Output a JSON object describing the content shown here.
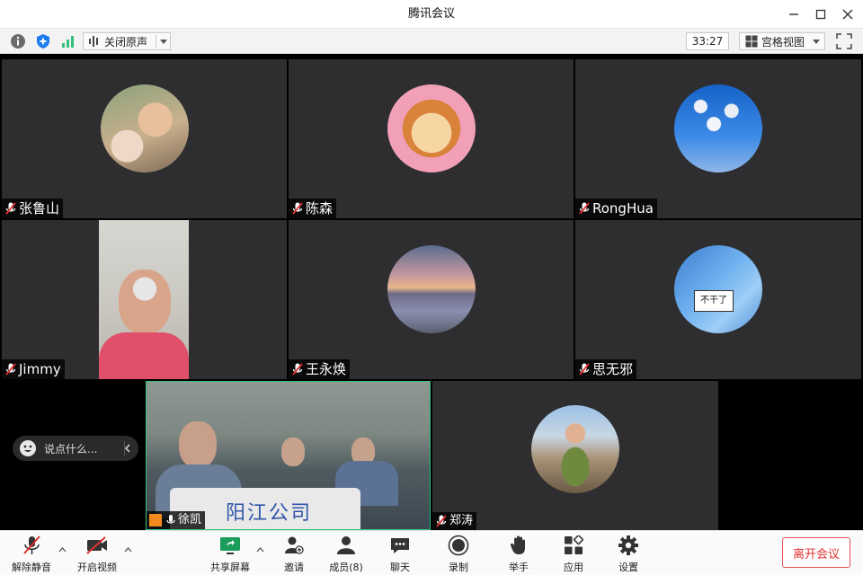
{
  "window": {
    "title": "腾讯会议"
  },
  "infobar": {
    "audio_label": "关闭原声",
    "timer": "33:27",
    "view_label": "宫格视图"
  },
  "participants": [
    {
      "name": "张鲁山"
    },
    {
      "name": "陈森"
    },
    {
      "name": "RongHua"
    },
    {
      "name": "Jimmy"
    },
    {
      "name": "王永焕"
    },
    {
      "name": "思无邪"
    },
    {
      "name": "徐凯"
    },
    {
      "name": "郑涛"
    }
  ],
  "video_overlay": {
    "sign_text": "阳江公司",
    "sticker_text": "不干了"
  },
  "chat": {
    "placeholder": "说点什么..."
  },
  "toolbar": {
    "unmute": "解除静音",
    "start_video": "开启视频",
    "share_screen": "共享屏幕",
    "invite": "邀请",
    "members": "成员(8)",
    "chat": "聊天",
    "record": "录制",
    "raise_hand": "举手",
    "apps": "应用",
    "settings": "设置",
    "leave": "离开会议"
  },
  "colors": {
    "accent_green": "#31c27c",
    "leave_red": "#e03030",
    "tile_bg": "#2e2e31"
  }
}
